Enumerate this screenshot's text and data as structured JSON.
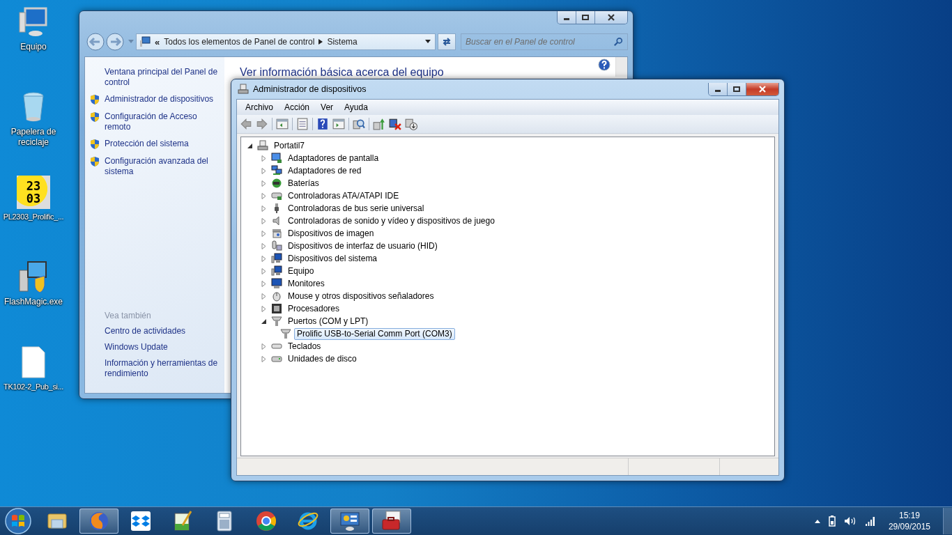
{
  "desktop_icons": [
    {
      "kind": "computer",
      "label": "Equipo"
    },
    {
      "kind": "recycle-bin",
      "label": "Papelera de reciclaje"
    },
    {
      "kind": "digits-installer",
      "label": "PL2303_Prolific_...",
      "icon_text": [
        "23",
        "03"
      ]
    },
    {
      "kind": "installer",
      "label": "FlashMagic.exe"
    },
    {
      "kind": "file",
      "label": "TK102-2_Pub_si..."
    }
  ],
  "control_panel": {
    "address": {
      "overflow": "«",
      "crumbs": [
        "Todos los elementos de Panel de control",
        "Sistema"
      ]
    },
    "search": {
      "placeholder": "Buscar en el Panel de control"
    },
    "sidebar": {
      "links": [
        {
          "label": "Ventana principal del Panel de control",
          "shield": false
        },
        {
          "label": "Administrador de dispositivos",
          "shield": true
        },
        {
          "label": "Configuración de Acceso remoto",
          "shield": true
        },
        {
          "label": "Protección del sistema",
          "shield": true
        },
        {
          "label": "Configuración avanzada del sistema",
          "shield": true
        }
      ],
      "see_also_heading": "Vea también",
      "see_also": [
        "Centro de actividades",
        "Windows Update",
        "Información y herramientas de rendimiento"
      ]
    },
    "heading": "Ver información básica acerca del equipo"
  },
  "device_manager": {
    "title": "Administrador de dispositivos",
    "menu": [
      "Archivo",
      "Acción",
      "Ver",
      "Ayuda"
    ],
    "tree": {
      "label": "Portatil7",
      "kind": "laptop",
      "expanded": true,
      "selected": false,
      "children": [
        {
          "label": "Adaptadores de pantalla",
          "kind": "display",
          "expanded": false,
          "selected": false
        },
        {
          "label": "Adaptadores de red",
          "kind": "network",
          "expanded": false,
          "selected": false
        },
        {
          "label": "Baterías",
          "kind": "battery",
          "expanded": false,
          "selected": false
        },
        {
          "label": "Controladoras ATA/ATAPI IDE",
          "kind": "ata",
          "expanded": false,
          "selected": false
        },
        {
          "label": "Controladoras de bus serie universal",
          "kind": "usb",
          "expanded": false,
          "selected": false
        },
        {
          "label": "Controladoras de sonido y vídeo y dispositivos de juego",
          "kind": "speaker",
          "expanded": false,
          "selected": false
        },
        {
          "label": "Dispositivos de imagen",
          "kind": "imaging",
          "expanded": false,
          "selected": false
        },
        {
          "label": "Dispositivos de interfaz de usuario (HID)",
          "kind": "hid",
          "expanded": false,
          "selected": false
        },
        {
          "label": "Dispositivos del sistema",
          "kind": "system",
          "expanded": false,
          "selected": false
        },
        {
          "label": "Equipo",
          "kind": "system",
          "expanded": false,
          "selected": false
        },
        {
          "label": "Monitores",
          "kind": "monitor",
          "expanded": false,
          "selected": false
        },
        {
          "label": "Mouse y otros dispositivos señaladores",
          "kind": "mouse",
          "expanded": false,
          "selected": false
        },
        {
          "label": "Procesadores",
          "kind": "cpu",
          "expanded": false,
          "selected": false
        },
        {
          "label": "Puertos (COM y LPT)",
          "kind": "port",
          "expanded": true,
          "selected": false,
          "children": [
            {
              "label": "Prolific USB-to-Serial Comm Port (COM3)",
              "kind": "port",
              "selected": true
            }
          ]
        },
        {
          "label": "Teclados",
          "kind": "keyboard",
          "expanded": false,
          "selected": false
        },
        {
          "label": "Unidades de disco",
          "kind": "disk",
          "expanded": false,
          "selected": false
        }
      ]
    }
  },
  "taskbar": {
    "apps": [
      {
        "kind": "folders",
        "running": false
      },
      {
        "kind": "firefox",
        "running": true
      },
      {
        "kind": "dropbox",
        "running": false
      },
      {
        "kind": "notepad",
        "running": false
      },
      {
        "kind": "calculator",
        "running": false
      },
      {
        "kind": "chrome",
        "running": false
      },
      {
        "kind": "ie",
        "running": false
      },
      {
        "kind": "control-panel",
        "running": true
      },
      {
        "kind": "toolbox",
        "running": true
      }
    ],
    "clock": {
      "time": "15:19",
      "date": "29/09/2015"
    }
  }
}
